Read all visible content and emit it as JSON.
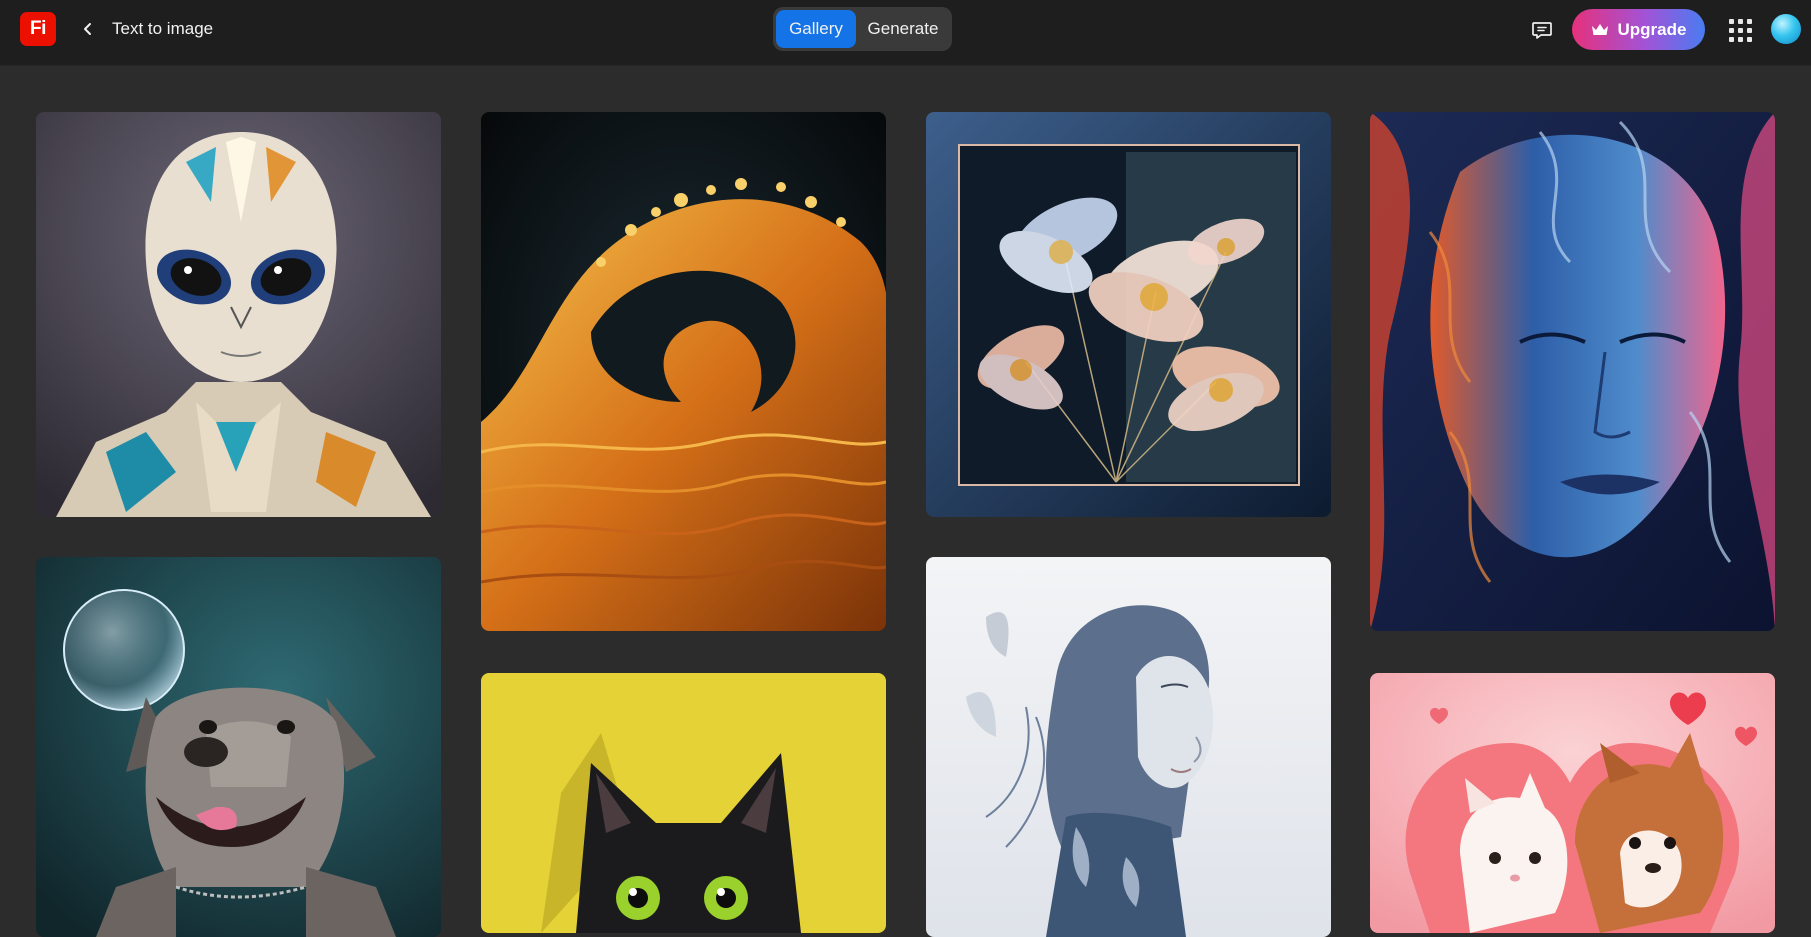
{
  "app": {
    "logo_text": "Fi",
    "logo_color": "#eb1000"
  },
  "header": {
    "back_icon": "chevron-left-icon",
    "title": "Text to image"
  },
  "tabs": [
    {
      "label": "Gallery",
      "active": true
    },
    {
      "label": "Generate",
      "active": false
    }
  ],
  "actions": {
    "feedback_icon": "feedback-icon",
    "upgrade_label": "Upgrade",
    "upgrade_icon": "crown-icon",
    "apps_icon": "app-switcher-icon",
    "avatar": "user-avatar"
  },
  "colors": {
    "accent": "#1473e6",
    "background": "#2c2c2c",
    "topbar": "#1e1e1e",
    "upgrade_gradient": [
      "#e6317c",
      "#a253d6",
      "#4a7cf2"
    ]
  },
  "gallery": [
    {
      "subject": "geometric origami alien"
    },
    {
      "subject": "golden fractal wave"
    },
    {
      "subject": "translucent flowers in glass frame"
    },
    {
      "subject": "woman face made of colored smoke"
    },
    {
      "subject": "dog with soap bubble"
    },
    {
      "subject": "black cat on yellow background"
    },
    {
      "subject": "double exposure woman portrait"
    },
    {
      "subject": "kitten and puppy in pink heart"
    }
  ]
}
